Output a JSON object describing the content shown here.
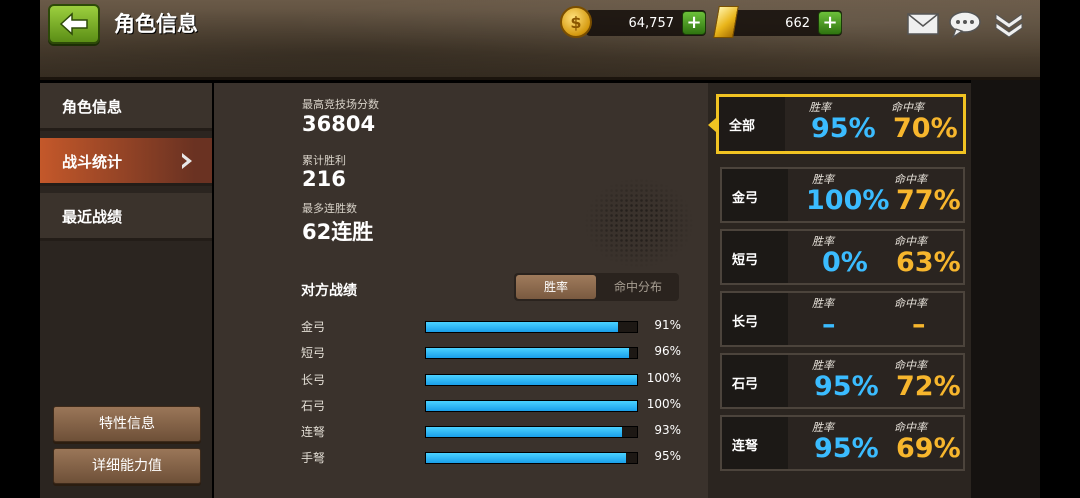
{
  "header": {
    "title": "角色信息",
    "coins": "64,757",
    "gold": "662",
    "coin_symbol": "$"
  },
  "nav": {
    "items": [
      {
        "label": "角色信息",
        "active": false
      },
      {
        "label": "战斗统计",
        "active": true
      },
      {
        "label": "最近战绩",
        "active": false
      }
    ],
    "buttons": [
      "特性信息",
      "详细能力值"
    ]
  },
  "stats": {
    "arena_label": "最高竞技场分数",
    "arena_value": "36804",
    "wins_label": "累计胜利",
    "wins_value": "216",
    "streak_label": "最多连胜数",
    "streak_value": "62连胜"
  },
  "opponents": {
    "title": "对方战绩",
    "toggle": {
      "on": "胜率",
      "off": "命中分布"
    },
    "rows": [
      {
        "name": "金弓",
        "value": 91,
        "label": "91%"
      },
      {
        "name": "短弓",
        "value": 96,
        "label": "96%"
      },
      {
        "name": "长弓",
        "value": 100,
        "label": "100%"
      },
      {
        "name": "石弓",
        "value": 100,
        "label": "100%"
      },
      {
        "name": "连弩",
        "value": 93,
        "label": "93%"
      },
      {
        "name": "手弩",
        "value": 95,
        "label": "95%"
      }
    ]
  },
  "cards": {
    "win_header": "胜率",
    "hit_header": "命中率",
    "items": [
      {
        "name": "全部",
        "win": "95%",
        "hit": "70%"
      },
      {
        "name": "金弓",
        "win": "100%",
        "hit": "77%"
      },
      {
        "name": "短弓",
        "win": "0%",
        "hit": "63%"
      },
      {
        "name": "长弓",
        "win": "–",
        "hit": "–"
      },
      {
        "name": "石弓",
        "win": "95%",
        "hit": "72%"
      },
      {
        "name": "连弩",
        "win": "95%",
        "hit": "69%"
      }
    ]
  },
  "colors": {
    "win": "#3bbcff",
    "hit": "#f7b62d",
    "selected": "#f1c322",
    "bar": "#1aa0ea"
  }
}
